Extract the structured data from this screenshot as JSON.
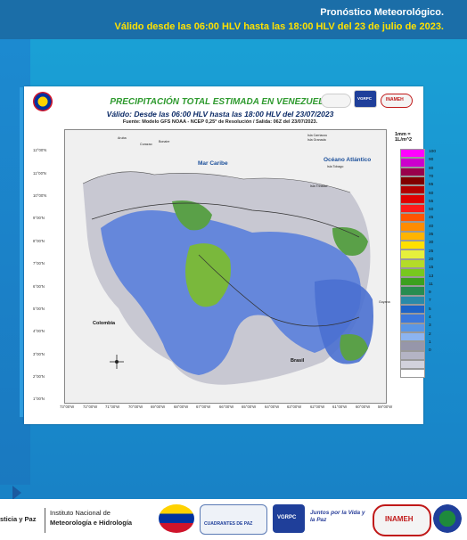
{
  "header": {
    "line1": "Pronóstico Meteorológico.",
    "line2": "Válido desde las 06:00 HLV hasta las 18:00 HLV del 23 de julio de 2023."
  },
  "map": {
    "title": "PRECIPITACIÓN TOTAL ESTIMADA EN VENEZUELA",
    "subtitle": "Válido: Desde las 06:00 HLV  hasta las 18:00 HLV del 23/07/2023",
    "source": "Fuente: Modelo GFS NOAA - NCEP 0,25° de Resolución / Salida: 06Z del 23/07/2023.",
    "logos": [
      "VGRPC",
      "INAMEH"
    ],
    "legend": {
      "unit": "1mm = 1L/m^2",
      "levels": [
        {
          "value": "100",
          "color": "#ff00ff"
        },
        {
          "value": "90",
          "color": "#cc00cc"
        },
        {
          "value": "80",
          "color": "#99004c"
        },
        {
          "value": "70",
          "color": "#800000"
        },
        {
          "value": "65",
          "color": "#b20000"
        },
        {
          "value": "60",
          "color": "#e00000"
        },
        {
          "value": "55",
          "color": "#ff1a1a"
        },
        {
          "value": "50",
          "color": "#ff5500"
        },
        {
          "value": "45",
          "color": "#ff8c00"
        },
        {
          "value": "40",
          "color": "#ffb400"
        },
        {
          "value": "35",
          "color": "#ffe000"
        },
        {
          "value": "30",
          "color": "#e6f03c"
        },
        {
          "value": "25",
          "color": "#b4dc28"
        },
        {
          "value": "20",
          "color": "#78c81e"
        },
        {
          "value": "15",
          "color": "#3ca01e"
        },
        {
          "value": "13",
          "color": "#288c50"
        },
        {
          "value": "11",
          "color": "#2a8aa8"
        },
        {
          "value": "9",
          "color": "#1e64c8"
        },
        {
          "value": "7",
          "color": "#3c78dc"
        },
        {
          "value": "5",
          "color": "#5a96e6"
        },
        {
          "value": "4",
          "color": "#8cb4f0"
        },
        {
          "value": "3",
          "color": "#9696aa"
        },
        {
          "value": "2",
          "color": "#b4b4c4"
        },
        {
          "value": "1",
          "color": "#d2d2dc"
        },
        {
          "value": "0",
          "color": "#ffffff"
        }
      ]
    },
    "y_ticks": [
      "12°00'N",
      "11°00'N",
      "10°00'N",
      "9°00'N",
      "8°00'N",
      "7°00'N",
      "6°00'N",
      "5°00'N",
      "4°00'N",
      "3°00'N",
      "2°00'N",
      "1°00'N"
    ],
    "x_ticks": [
      "73°00'W",
      "72°00'W",
      "71°00'W",
      "70°00'W",
      "69°00'W",
      "68°00'W",
      "67°00'W",
      "66°00'W",
      "65°00'W",
      "64°00'W",
      "63°00'W",
      "62°00'W",
      "61°00'W",
      "60°00'W",
      "59°00'W"
    ],
    "places": {
      "mar_caribe": "Mar Caribe",
      "oceano": "Océano Atlántico",
      "colombia": "Colombia",
      "brasil": "Brasil",
      "aruba": "Aruba",
      "curazao": "Curazao",
      "bonaire": "Bonaire",
      "isla_carriacou": "Isla Carriacou",
      "isla_granada": "Isla Granada",
      "isla_tobago": "Isla Tobago",
      "isla_trinidad": "Isla Trinidad",
      "guyana": "Guyana"
    }
  },
  "footer": {
    "left": "sticia y Paz",
    "institute_line1": "Instituto Nacional de",
    "institute_line2": "Meteorología e Hidrología",
    "logos": [
      "INAMEH",
      "CUADRANTES DE PAZ",
      "VGRPC",
      "Juntos por la Vida y la Paz",
      "INAMEH"
    ]
  }
}
